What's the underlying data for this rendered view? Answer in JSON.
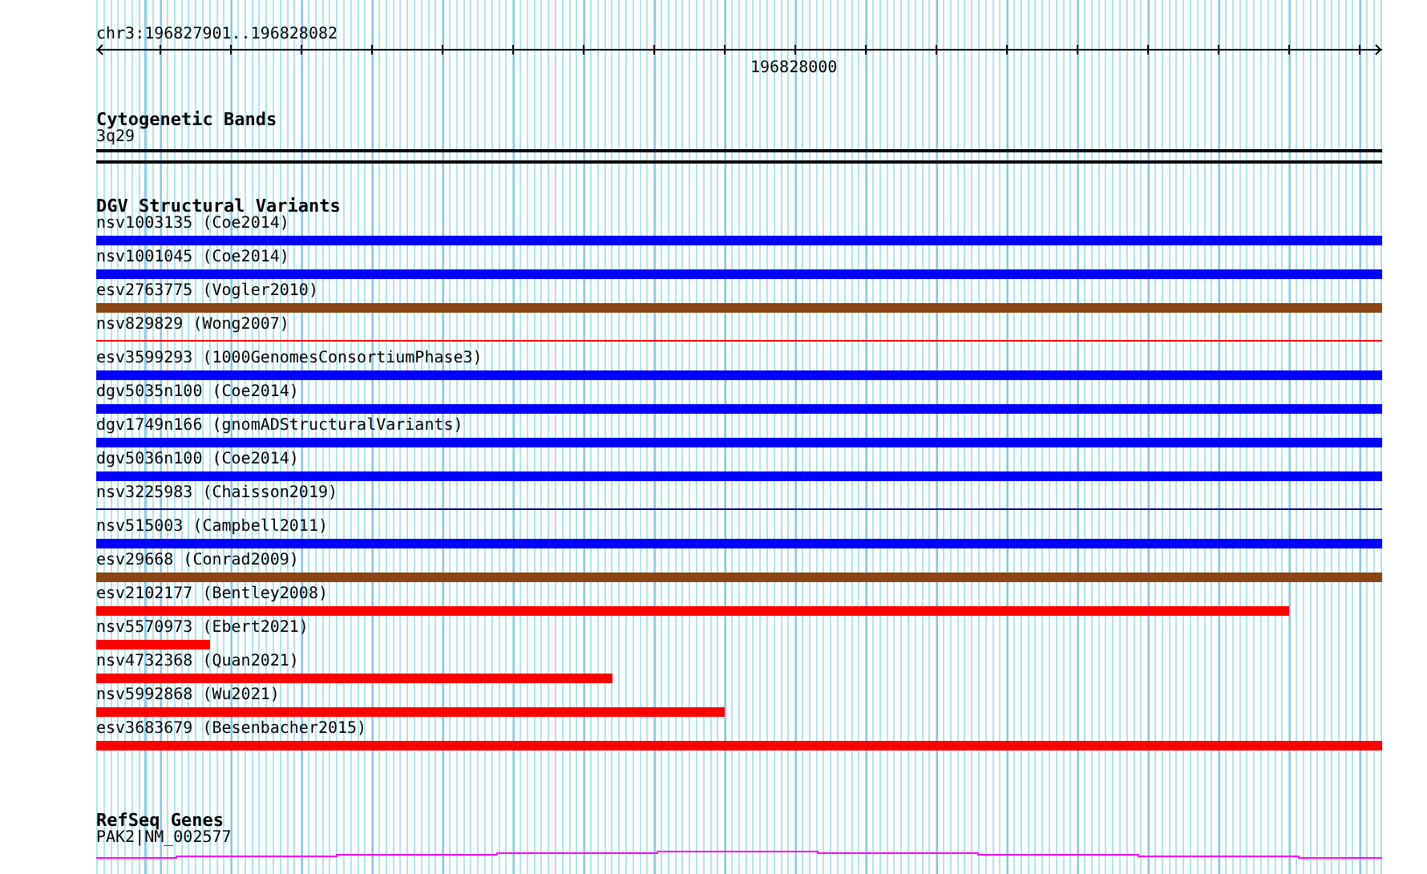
{
  "ruler": {
    "location": "chr3:196827901..196828082",
    "tick_label": "196828000"
  },
  "cytogenetic_bands": {
    "title": "Cytogenetic Bands",
    "band": "3q29"
  },
  "dgv_structural_variants": {
    "title": "DGV Structural Variants",
    "features": [
      {
        "label": "nsv1003135 (Coe2014)",
        "kind": "thick",
        "color": "#0000ff",
        "level": 1
      },
      {
        "label": "nsv1001045 (Coe2014)",
        "kind": "thick",
        "color": "#0000ff",
        "level": 1
      },
      {
        "label": "esv2763775 (Vogler2010)",
        "kind": "thick",
        "color": "#8b4513",
        "level": 1
      },
      {
        "label": "nsv829829 (Wong2007)",
        "kind": "thin",
        "color": "#ff0000",
        "level": 1
      },
      {
        "label": "esv3599293 (1000GenomesConsortiumPhase3)",
        "kind": "thick",
        "color": "#0000ff",
        "level": 1
      },
      {
        "label": "dgv5035n100 (Coe2014)",
        "kind": "thick",
        "color": "#0000ff",
        "level": 1
      },
      {
        "label": "dgv1749n166 (gnomADStructuralVariants)",
        "kind": "thick",
        "color": "#0000ff",
        "level": 1
      },
      {
        "label": "dgv5036n100 (Coe2014)",
        "kind": "thick",
        "color": "#0000ff",
        "level": 1
      },
      {
        "label": "nsv3225983 (Chaisson2019)",
        "kind": "thin",
        "color": "#00008b",
        "level": 1
      },
      {
        "label": "nsv515003 (Campbell2011)",
        "kind": "thick",
        "color": "#0000ff",
        "level": 1
      },
      {
        "label": "esv29668 (Conrad2009)",
        "kind": "thick",
        "color": "#8b4513",
        "level": 1
      },
      {
        "label": "esv2102177 (Bentley2008)",
        "kind": "thick",
        "color": "#ff0000",
        "level": 0.928
      },
      {
        "label": "nsv5570973 (Ebert2021)",
        "kind": "thick",
        "color": "#ff0000",
        "level": 0.089
      },
      {
        "label": "nsv4732368 (Quan2021)",
        "kind": "thick",
        "color": "#ff0000",
        "level": 0.401
      },
      {
        "label": "nsv5992868 (Wu2021)",
        "kind": "thick",
        "color": "#ff0000",
        "level": 0.489
      },
      {
        "label": "esv3683679 (Besenbacher2015)",
        "kind": "thick",
        "color": "#ff0000",
        "level": 1
      }
    ]
  },
  "refseq_genes": {
    "title": "RefSeq Genes",
    "gene": "PAK2|NM_002577"
  }
}
